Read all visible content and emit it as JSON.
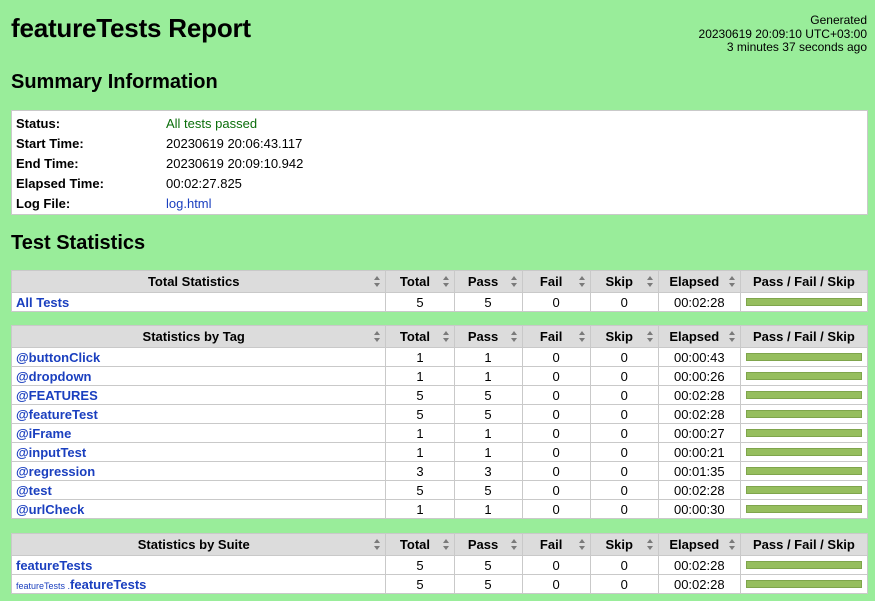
{
  "header": {
    "title": "featureTests Report",
    "generated_label": "Generated",
    "generated_time": "20230619 20:09:10 UTC+03:00",
    "generated_ago": "3 minutes 37 seconds ago"
  },
  "summary": {
    "title": "Summary Information",
    "rows": [
      {
        "key": "Status:",
        "value": "All tests passed"
      },
      {
        "key": "Start Time:",
        "value": "20230619 20:06:43.117"
      },
      {
        "key": "End Time:",
        "value": "20230619 20:09:10.942"
      },
      {
        "key": "Elapsed Time:",
        "value": "00:02:27.825"
      },
      {
        "key": "Log File:",
        "value": "log.html"
      }
    ]
  },
  "stats_title": "Test Statistics",
  "columns": {
    "total": "Total",
    "pass": "Pass",
    "fail": "Fail",
    "skip": "Skip",
    "elapsed": "Elapsed",
    "graph": "Pass / Fail / Skip"
  },
  "total_stats": {
    "header": "Total Statistics",
    "rows": [
      {
        "name": "All Tests",
        "total": "5",
        "pass": "5",
        "fail": "0",
        "skip": "0",
        "elapsed": "00:02:28",
        "pass_ratio": 1.0
      }
    ]
  },
  "tag_stats": {
    "header": "Statistics by Tag",
    "rows": [
      {
        "name": "@buttonClick",
        "total": "1",
        "pass": "1",
        "fail": "0",
        "skip": "0",
        "elapsed": "00:00:43",
        "pass_ratio": 1.0
      },
      {
        "name": "@dropdown",
        "total": "1",
        "pass": "1",
        "fail": "0",
        "skip": "0",
        "elapsed": "00:00:26",
        "pass_ratio": 1.0
      },
      {
        "name": "@FEATURES",
        "total": "5",
        "pass": "5",
        "fail": "0",
        "skip": "0",
        "elapsed": "00:02:28",
        "pass_ratio": 1.0
      },
      {
        "name": "@featureTest",
        "total": "5",
        "pass": "5",
        "fail": "0",
        "skip": "0",
        "elapsed": "00:02:28",
        "pass_ratio": 1.0
      },
      {
        "name": "@iFrame",
        "total": "1",
        "pass": "1",
        "fail": "0",
        "skip": "0",
        "elapsed": "00:00:27",
        "pass_ratio": 1.0
      },
      {
        "name": "@inputTest",
        "total": "1",
        "pass": "1",
        "fail": "0",
        "skip": "0",
        "elapsed": "00:00:21",
        "pass_ratio": 1.0
      },
      {
        "name": "@regression",
        "total": "3",
        "pass": "3",
        "fail": "0",
        "skip": "0",
        "elapsed": "00:01:35",
        "pass_ratio": 1.0
      },
      {
        "name": "@test",
        "total": "5",
        "pass": "5",
        "fail": "0",
        "skip": "0",
        "elapsed": "00:02:28",
        "pass_ratio": 1.0
      },
      {
        "name": "@urlCheck",
        "total": "1",
        "pass": "1",
        "fail": "0",
        "skip": "0",
        "elapsed": "00:00:30",
        "pass_ratio": 1.0
      }
    ]
  },
  "suite_stats": {
    "header": "Statistics by Suite",
    "rows": [
      {
        "parent": "",
        "name": "featureTests",
        "total": "5",
        "pass": "5",
        "fail": "0",
        "skip": "0",
        "elapsed": "00:02:28",
        "pass_ratio": 1.0
      },
      {
        "parent": "featureTests .",
        "name": "featureTests",
        "total": "5",
        "pass": "5",
        "fail": "0",
        "skip": "0",
        "elapsed": "00:02:28",
        "pass_ratio": 1.0
      }
    ]
  },
  "colors": {
    "background": "#99ed9a",
    "pass_bar": "#96be5e",
    "link": "#1a3fbf",
    "pass_text": "#0b6e0b"
  }
}
